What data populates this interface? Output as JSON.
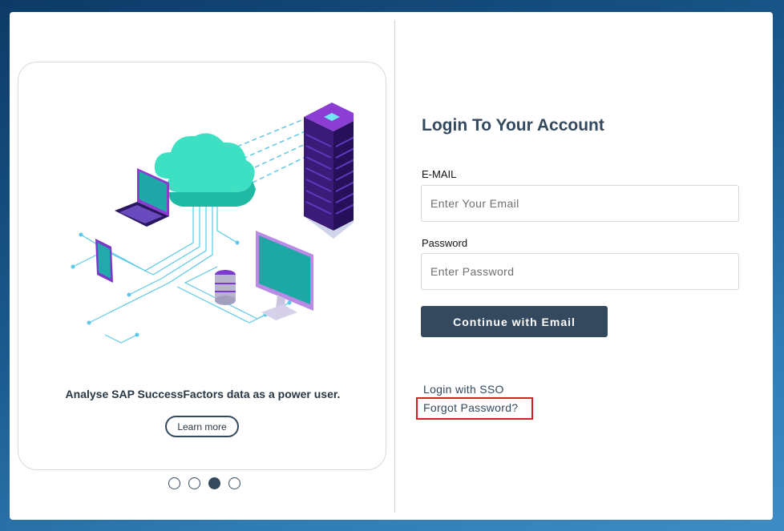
{
  "promo": {
    "text": "Analyse SAP SuccessFactors data as a power user.",
    "learn_more_label": "Learn more",
    "carousel": {
      "total": 4,
      "active_index": 3
    }
  },
  "login": {
    "title": "Login To Your Account",
    "email_label": "E-MAIL",
    "email_placeholder": "Enter Your Email",
    "email_value": "",
    "password_label": "Password",
    "password_placeholder": "Enter Password",
    "password_value": "",
    "continue_label": "Continue with Email",
    "sso_label": "Login with SSO",
    "forgot_label": "Forgot Password?"
  },
  "colors": {
    "accent": "#34495e",
    "highlight": "#d42020",
    "background": "#1b5b8f"
  }
}
